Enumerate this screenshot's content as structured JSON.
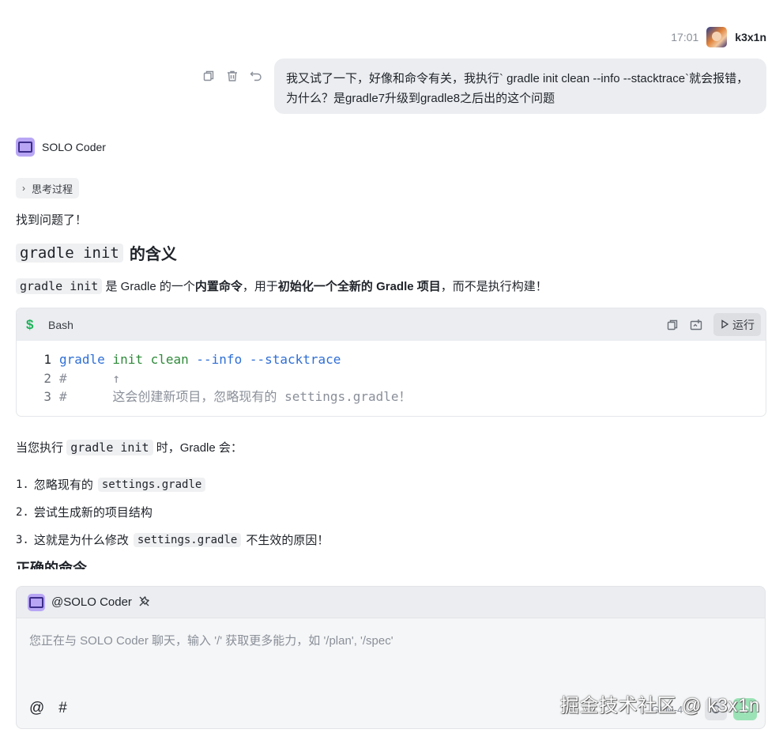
{
  "user_message": {
    "time": "17:01",
    "user_name": "k3x1n",
    "text": "我又试了一下，好像和命令有关，我执行` gradle  init clean --info --stacktrace`就会报错，为什么？是gradle7升级到gradle8之后出的这个问题"
  },
  "assistant": {
    "name": "SOLO Coder",
    "think_label": "思考过程",
    "found": "找到问题了！",
    "heading1_code": "gradle init",
    "heading1_text": "的含义",
    "para1": {
      "code": "gradle init",
      "t1": "是 Gradle 的一个",
      "b1": "内置命令",
      "t2": "，用于",
      "b2": "初始化一个全新的 Gradle 项目",
      "t3": "，而不是执行构建！"
    },
    "codeblock": {
      "lang": "Bash",
      "run_label": "运行",
      "lines": [
        {
          "num": "1",
          "cmd": "gradle",
          "arg": " init clean",
          "flags": " --info --stacktrace"
        },
        {
          "num": "2",
          "comment": "#      ↑"
        },
        {
          "num": "3",
          "comment": "#      这会创建新项目，忽略现有的 settings.gradle！"
        }
      ]
    },
    "para2": {
      "t1": "当您执行",
      "code": "gradle init",
      "t2": "时，Gradle 会："
    },
    "list": [
      {
        "num": "1.",
        "text": "忽略现有的",
        "code": "settings.gradle",
        "tail": ""
      },
      {
        "num": "2.",
        "text": "尝试生成新的项目结构",
        "code": "",
        "tail": ""
      },
      {
        "num": "3.",
        "text": "这就是为什么修改",
        "code": "settings.gradle",
        "tail": "不生效的原因！"
      }
    ],
    "heading2": "正确的命令"
  },
  "input": {
    "mention": "@SOLO Coder",
    "placeholder": "您正在与 SOLO Coder 聊天，输入 '/' 获取更多能力，如 '/plan', '/spec'",
    "at_symbol": "@",
    "hash_symbol": "#",
    "model": "GLM-4"
  },
  "watermark": "掘金技术社区 @ k3x1n"
}
